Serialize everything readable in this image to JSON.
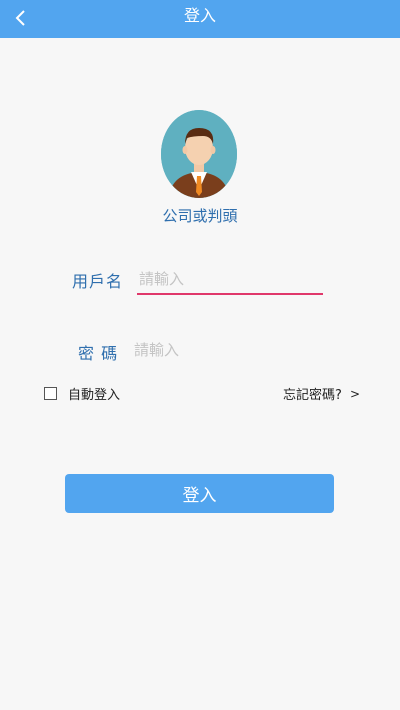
{
  "header": {
    "title": "登入"
  },
  "profile": {
    "company_label": "公司或判頭"
  },
  "form": {
    "username": {
      "label": "用戶名",
      "placeholder": "請輸入",
      "value": ""
    },
    "password": {
      "label": "密 碼",
      "placeholder": "請輸入",
      "value": ""
    },
    "auto_login_label": "自動登入",
    "auto_login_checked": false,
    "forgot_label": "忘記密碼?",
    "forgot_chevron": ">"
  },
  "actions": {
    "login_label": "登入"
  },
  "colors": {
    "primary": "#52a5ef",
    "label_blue": "#2f6fae",
    "active_underline": "#e0386b",
    "background": "#f7f7f7"
  },
  "icons": {
    "back": "chevron-left-icon",
    "avatar": "man-avatar-icon"
  }
}
